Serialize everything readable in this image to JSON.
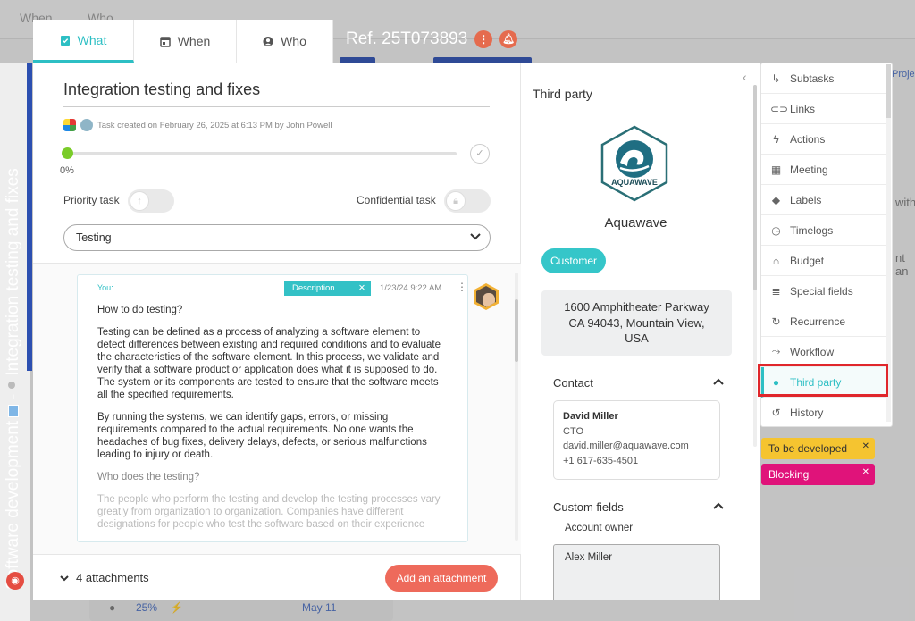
{
  "background": {
    "tabs": [
      "When",
      "Who"
    ],
    "right_texts": [
      "Proje",
      "with",
      "nt an"
    ],
    "bottom_card": {
      "percent": "25%",
      "date": "May 11"
    },
    "project_title": "Software development",
    "task_vertical": "Integration testing and fixes"
  },
  "tabs": [
    {
      "label": "What",
      "icon": "clipboard-check-icon",
      "active": true
    },
    {
      "label": "When",
      "icon": "calendar-icon",
      "active": false
    },
    {
      "label": "Who",
      "icon": "user-circle-icon",
      "active": false
    }
  ],
  "ref": "Ref. 25T073893",
  "task": {
    "title": "Integration testing and fixes",
    "meta": "Task created on February 26, 2025 at 6:13 PM by John Powell",
    "progress": "0%",
    "progress_value": 0,
    "priority_label": "Priority task",
    "confidential_label": "Confidential task",
    "status": "Testing"
  },
  "comment": {
    "author": "You:",
    "tag": "Description",
    "date": "1/23/24 9:22 AM",
    "q1": "How to do testing?",
    "p1": "Testing can be defined as a process of analyzing a software element to detect differences between existing and required conditions and to evaluate the characteristics of the software element. In this process, we validate and verify that a software product or application does what it is supposed to do. The system or its components are tested to ensure that the software meets all the specified requirements.",
    "p2": "By running the systems, we can identify gaps, errors, or missing requirements compared to the actual requirements. No one wants the headaches of bug fixes, delivery delays, defects, or serious malfunctions leading to injury or death.",
    "q2": "Who does the testing?",
    "p3": "The people who perform the testing and develop the testing processes vary greatly from organization to organization. Companies have different designations for people who test the software based on their experience"
  },
  "attachments": {
    "count_label": "4 attachments",
    "add_button": "Add an attachment"
  },
  "third_party": {
    "title": "Third party",
    "logo_text": "AQUAWAVE",
    "company": "Aquawave",
    "type": "Customer",
    "address": [
      "1600 Amphitheater Parkway",
      "CA 94043, Mountain View,",
      "USA"
    ],
    "contact_heading": "Contact",
    "contact": {
      "name": "David Miller",
      "role": "CTO",
      "email": "david.miller@aquawave.com",
      "phone": "+1 617-635-4501"
    },
    "custom_fields_heading": "Custom fields",
    "account_owner_label": "Account owner",
    "account_owner_value": "Alex Miller"
  },
  "side_menu": [
    {
      "label": "Subtasks",
      "icon": "subtask-arrow-icon"
    },
    {
      "label": "Links",
      "icon": "link-icon"
    },
    {
      "label": "Actions",
      "icon": "lightning-icon"
    },
    {
      "label": "Meeting",
      "icon": "calendar-meeting-icon"
    },
    {
      "label": "Labels",
      "icon": "tag-icon"
    },
    {
      "label": "Timelogs",
      "icon": "clock-icon"
    },
    {
      "label": "Budget",
      "icon": "bank-icon"
    },
    {
      "label": "Special fields",
      "icon": "list-icon"
    },
    {
      "label": "Recurrence",
      "icon": "recurrence-icon"
    },
    {
      "label": "Workflow",
      "icon": "workflow-icon"
    },
    {
      "label": "Third party",
      "icon": "person-icon",
      "active": true
    },
    {
      "label": "History",
      "icon": "history-icon"
    }
  ],
  "labels": [
    {
      "text": "To be developed",
      "color": "#f5c430"
    },
    {
      "text": "Blocking",
      "color": "#e0137a"
    }
  ],
  "colors": {
    "accent": "#2dbfc4",
    "attach_button": "#ee6a5b",
    "progress_dot": "#7acc29",
    "highlight": "#e0262b"
  }
}
